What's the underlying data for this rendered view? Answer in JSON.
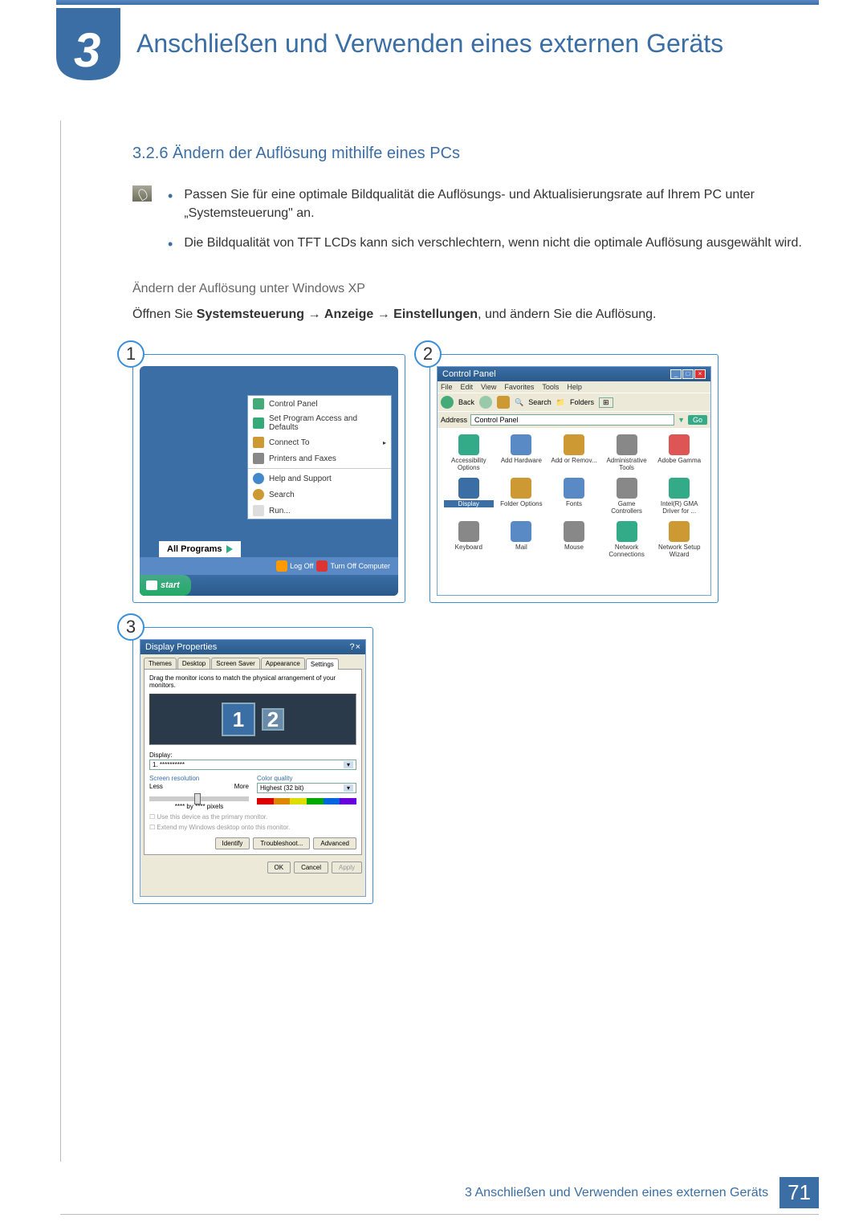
{
  "header": {
    "chapter_number": "3",
    "title": "Anschließen und Verwenden eines externen Geräts"
  },
  "section": {
    "number": "3.2.6",
    "title": "Ändern der Auflösung mithilfe eines PCs"
  },
  "bullets": [
    "Passen Sie für eine optimale Bildqualität die Auflösungs- und Aktualisierungsrate auf Ihrem PC unter „Systemsteuerung\" an.",
    "Die Bildqualität von TFT LCDs kann sich verschlechtern, wenn nicht die optimale Auflösung ausgewählt wird."
  ],
  "subheading": "Ändern der Auflösung unter Windows XP",
  "instruction": {
    "pre": "Öffnen Sie ",
    "b1": "Systemsteuerung",
    "a1": " → ",
    "b2": "Anzeige",
    "a2": " → ",
    "b3": "Einstellungen",
    "post": ", und ändern Sie die Auflösung."
  },
  "panels": {
    "n1": "1",
    "n2": "2",
    "n3": "3"
  },
  "start_menu": {
    "items": [
      {
        "label": "Control Panel",
        "arrow": ""
      },
      {
        "label": "Set Program Access and Defaults",
        "arrow": ""
      },
      {
        "label": "Connect To",
        "arrow": "▸"
      },
      {
        "label": "Printers and Faxes",
        "arrow": ""
      },
      {
        "label": "Help and Support",
        "arrow": ""
      },
      {
        "label": "Search",
        "arrow": ""
      },
      {
        "label": "Run...",
        "arrow": ""
      }
    ],
    "all_programs": "All Programs",
    "logoff": "Log Off",
    "turnoff": "Turn Off Computer",
    "start": "start"
  },
  "control_panel": {
    "title": "Control Panel",
    "menu": [
      "File",
      "Edit",
      "View",
      "Favorites",
      "Tools",
      "Help"
    ],
    "toolbar": {
      "back": "Back",
      "search": "Search",
      "folders": "Folders"
    },
    "address_label": "Address",
    "address_value": "Control Panel",
    "go": "Go",
    "icons": [
      {
        "label": "Accessibility Options"
      },
      {
        "label": "Add Hardware"
      },
      {
        "label": "Add or Remov..."
      },
      {
        "label": "Administrative Tools"
      },
      {
        "label": "Adobe Gamma"
      },
      {
        "label": "Display",
        "highlight": true
      },
      {
        "label": "Folder Options"
      },
      {
        "label": "Fonts"
      },
      {
        "label": "Game Controllers"
      },
      {
        "label": "Intel(R) GMA Driver for ..."
      },
      {
        "label": "Keyboard"
      },
      {
        "label": "Mail"
      },
      {
        "label": "Mouse"
      },
      {
        "label": "Network Connections"
      },
      {
        "label": "Network Setup Wizard"
      }
    ]
  },
  "display_props": {
    "title": "Display Properties",
    "tabs": [
      "Themes",
      "Desktop",
      "Screen Saver",
      "Appearance",
      "Settings"
    ],
    "hint": "Drag the monitor icons to match the physical arrangement of your monitors.",
    "mon1": "1",
    "mon2": "2",
    "display_label": "Display:",
    "display_value": "1. **********",
    "res_label": "Screen resolution",
    "less": "Less",
    "more": "More",
    "pixels": "**** by **** pixels",
    "cq_label": "Color quality",
    "cq_value": "Highest (32 bit)",
    "check1": "Use this device as the primary monitor.",
    "check2": "Extend my Windows desktop onto this monitor.",
    "btns": {
      "identify": "Identify",
      "troubleshoot": "Troubleshoot...",
      "advanced": "Advanced"
    },
    "footer": {
      "ok": "OK",
      "cancel": "Cancel",
      "apply": "Apply"
    }
  },
  "footer": {
    "text": "3 Anschließen und Verwenden eines externen Geräts",
    "page": "71"
  }
}
